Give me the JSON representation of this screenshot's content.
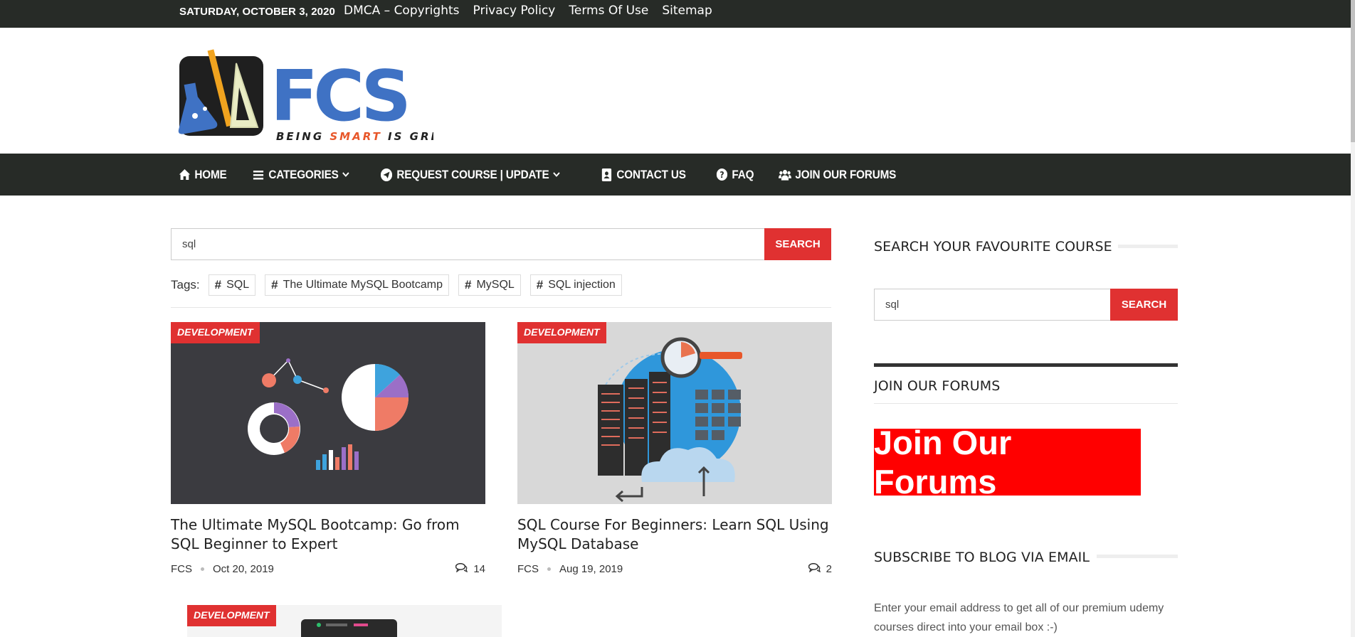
{
  "topbar": {
    "date": "SATURDAY, OCTOBER 3, 2020",
    "links": [
      "DMCA – Copyrights",
      "Privacy Policy",
      "Terms Of Use",
      "Sitemap"
    ]
  },
  "logo": {
    "text": "FCS",
    "tagline_pre": "BEING ",
    "tagline_accent": "SMART",
    "tagline_post": " IS GREAT",
    "colors": {
      "blue": "#3f72c4",
      "accent": "#e8572a",
      "dark": "#222"
    }
  },
  "nav": {
    "items": [
      {
        "label": "HOME",
        "icon": "home-icon"
      },
      {
        "label": "CATEGORIES",
        "icon": "bars-icon",
        "dropdown": true
      },
      {
        "label": "REQUEST COURSE | UPDATE",
        "icon": "paper-plane-icon",
        "dropdown": true
      },
      {
        "label": "CONTACT US",
        "icon": "address-card-icon"
      },
      {
        "label": "FAQ",
        "icon": "question-circle-icon"
      },
      {
        "label": "JOIN OUR FORUMS",
        "icon": "users-icon"
      }
    ]
  },
  "search": {
    "value": "sql",
    "button": "SEARCH"
  },
  "tags": {
    "label": "Tags:",
    "items": [
      "SQL",
      "The Ultimate MySQL Bootcamp",
      "MySQL",
      "SQL injection"
    ]
  },
  "posts": [
    {
      "category": "DEVELOPMENT",
      "title": "The Ultimate MySQL Bootcamp: Go from SQL Beginner to Expert",
      "author": "FCS",
      "date": "Oct 20, 2019",
      "comments": "14"
    },
    {
      "category": "DEVELOPMENT",
      "title": "SQL Course For Beginners: Learn SQL Using MySQL Database",
      "author": "FCS",
      "date": "Aug 19, 2019",
      "comments": "2"
    },
    {
      "category": "DEVELOPMENT"
    }
  ],
  "sidebar": {
    "search_title": "SEARCH YOUR FAVOURITE COURSE",
    "search_value": "sql",
    "search_button": "SEARCH",
    "forums_title": "JOIN OUR FORUMS",
    "forums_banner": "Join Our Forums",
    "subscribe_title": "SUBSCRIBE TO BLOG VIA EMAIL",
    "subscribe_text": "Enter your email address to get all of our premium udemy courses direct into your email box :-)"
  },
  "colors": {
    "dark_bar": "#272b27",
    "accent_red": "#e03131",
    "banner_red": "#ff0000"
  }
}
